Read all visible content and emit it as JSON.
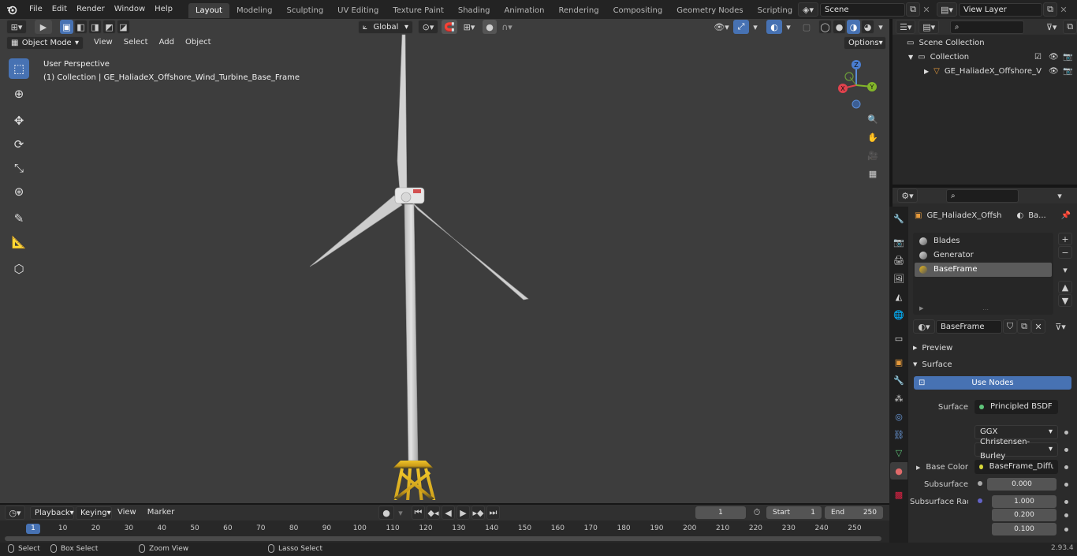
{
  "menu": {
    "file": "File",
    "edit": "Edit",
    "render": "Render",
    "window": "Window",
    "help": "Help"
  },
  "workspaces": [
    "Layout",
    "Modeling",
    "Sculpting",
    "UV Editing",
    "Texture Paint",
    "Shading",
    "Animation",
    "Rendering",
    "Compositing",
    "Geometry Nodes",
    "Scripting"
  ],
  "scene": {
    "name": "Scene",
    "view_layer": "View Layer"
  },
  "viewport": {
    "mode": "Object Mode",
    "menus": [
      "View",
      "Select",
      "Add",
      "Object"
    ],
    "transform_orientation": "Global",
    "options_label": "Options",
    "overlay_title": "User Perspective",
    "overlay_subtitle": "(1) Collection | GE_HaliadeX_Offshore_Wind_Turbine_Base_Frame",
    "gizmo_axes": {
      "x": "X",
      "y": "Y",
      "z": "Z"
    }
  },
  "outliner": {
    "scene_collection": "Scene Collection",
    "collection": "Collection",
    "object": "GE_HaliadeX_Offshore_V"
  },
  "properties": {
    "object_name": "GE_HaliadeX_Offshor...",
    "material_short": "Ba...",
    "slots": [
      "Blades",
      "Generator",
      "BaseFrame"
    ],
    "selected_slot": "BaseFrame",
    "material_name": "BaseFrame",
    "panels": {
      "preview": "Preview",
      "surface": "Surface"
    },
    "use_nodes": "Use Nodes",
    "surface_label": "Surface",
    "surface_value": "Principled BSDF",
    "distribution": "GGX",
    "subsurface_method": "Christensen-Burley",
    "base_color_label": "Base Color",
    "base_color_value": "BaseFrame_Diffuse...",
    "subsurface_label": "Subsurface",
    "subsurface_value": "0.000",
    "subsurface_radius_label": "Subsurface Radi...",
    "subsurface_radius": [
      "1.000",
      "0.200",
      "0.100"
    ]
  },
  "timeline": {
    "menus": [
      "Playback",
      "Keying",
      "View",
      "Marker"
    ],
    "current_frame": "1",
    "start_label": "Start",
    "start_value": "1",
    "end_label": "End",
    "end_value": "250",
    "ticks": [
      "1",
      "10",
      "20",
      "30",
      "40",
      "50",
      "60",
      "70",
      "80",
      "90",
      "100",
      "110",
      "120",
      "130",
      "140",
      "150",
      "160",
      "170",
      "180",
      "190",
      "200",
      "210",
      "220",
      "230",
      "240",
      "250"
    ]
  },
  "status": {
    "select": "Select",
    "box_select": "Box Select",
    "zoom_view": "Zoom View",
    "lasso_select": "Lasso Select",
    "version": "2.93.4"
  },
  "colors": {
    "accent": "#4772b3",
    "turbine_white": "#d8d8d8",
    "frame_yellow": "#e3b51f",
    "viewport_bg": "#3d3d3d"
  }
}
